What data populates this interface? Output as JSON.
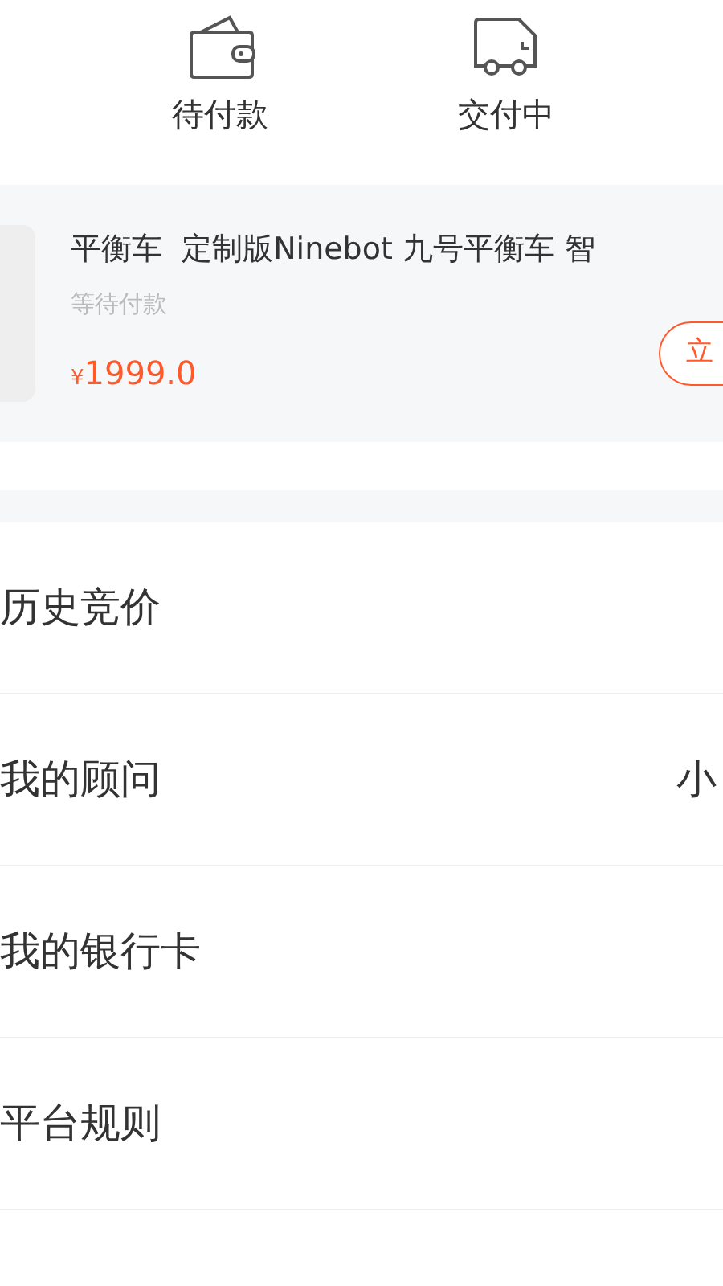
{
  "order_tabs": [
    {
      "kind": "wallet",
      "label": "待付款"
    },
    {
      "kind": "truck",
      "label": "交付中"
    }
  ],
  "order_card": {
    "title": "平衡车  定制版Ninebot 九号平衡车 智",
    "status": "等待付款",
    "currency": "¥",
    "amount": "1999.0",
    "action": "立"
  },
  "menu": [
    {
      "label": "历史竞价"
    },
    {
      "label": "我的顾问",
      "value": "小"
    },
    {
      "label": "我的银行卡"
    },
    {
      "label": "平台规则"
    }
  ]
}
